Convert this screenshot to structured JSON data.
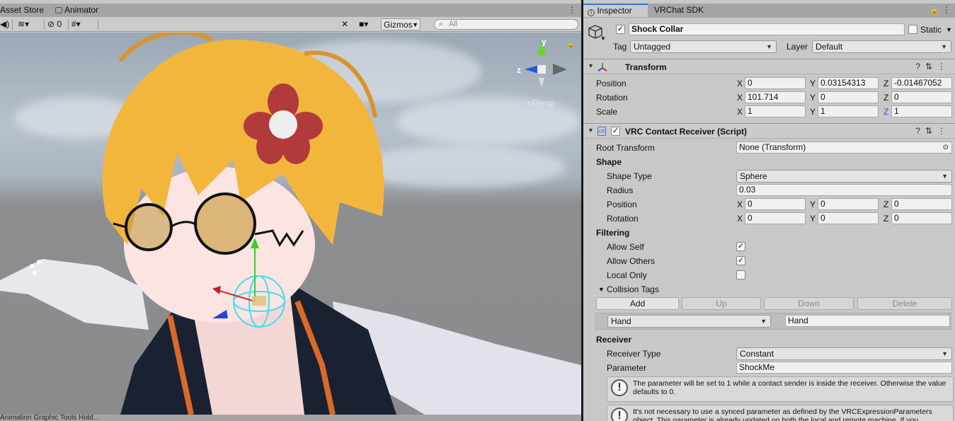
{
  "scene_panel": {
    "tabs": [
      {
        "label": "Asset Store"
      },
      {
        "label": "Animator"
      }
    ],
    "toolbar": {
      "hidden_count": "0",
      "gizmos_label": "Gizmos",
      "search_placeholder": "All"
    },
    "viewport": {
      "projection_label": "Persp",
      "axis_y": "y",
      "axis_z": "z"
    },
    "bottom_tabs_text": "Animation      Graphic Tools      Hold..."
  },
  "inspector": {
    "tabs": [
      {
        "label": "Inspector"
      },
      {
        "label": "VRChat SDK"
      }
    ],
    "object": {
      "active": true,
      "name": "Shock Collar",
      "static_label": "Static",
      "static": false,
      "tag_label": "Tag",
      "tag_value": "Untagged",
      "layer_label": "Layer",
      "layer_value": "Default"
    },
    "transform": {
      "title": "Transform",
      "position_label": "Position",
      "rotation_label": "Rotation",
      "scale_label": "Scale",
      "position": {
        "x": "0",
        "y": "0.03154313",
        "z": "-0.01467052"
      },
      "rotation": {
        "x": "101.714",
        "y": "0",
        "z": "0"
      },
      "scale": {
        "x": "1",
        "y": "1",
        "z": "1"
      }
    },
    "receiver": {
      "title": "VRC Contact Receiver (Script)",
      "enabled": true,
      "root_transform_label": "Root Transform",
      "root_transform_value": "None (Transform)",
      "shape_header": "Shape",
      "shape_type_label": "Shape Type",
      "shape_type_value": "Sphere",
      "radius_label": "Radius",
      "radius_value": "0.03",
      "position_label": "Position",
      "rotation_label": "Rotation",
      "position": {
        "x": "0",
        "y": "0",
        "z": "0"
      },
      "rotation": {
        "x": "0",
        "y": "0",
        "z": "0"
      },
      "filtering_header": "Filtering",
      "allow_self_label": "Allow Self",
      "allow_self": true,
      "allow_others_label": "Allow Others",
      "allow_others": true,
      "local_only_label": "Local Only",
      "local_only": false,
      "collision_tags_label": "Collision Tags",
      "list_buttons": {
        "add": "Add",
        "up": "Up",
        "down": "Down",
        "delete": "Delete"
      },
      "tag_entry": {
        "dropdown": "Hand",
        "value": "Hand"
      },
      "receiver_header": "Receiver",
      "receiver_type_label": "Receiver Type",
      "receiver_type_value": "Constant",
      "parameter_label": "Parameter",
      "parameter_value": "ShockMe",
      "help_1": "The parameter will be set to 1 while a contact sender is inside the receiver.  Otherwise the value defaults to 0.",
      "help_2": "It's not necessary to use a synced parameter as defined by the VRCExpressionParameters object.  This parameter is already updated on both the local and remote machine.  If you"
    }
  },
  "colors": {
    "panel_bg": "#c8c8c8",
    "tab_bar": "#a5a5a5",
    "field_bg": "#f0f0f0",
    "accent": "#3a72d8",
    "axis_blue": "#2a56c6"
  }
}
